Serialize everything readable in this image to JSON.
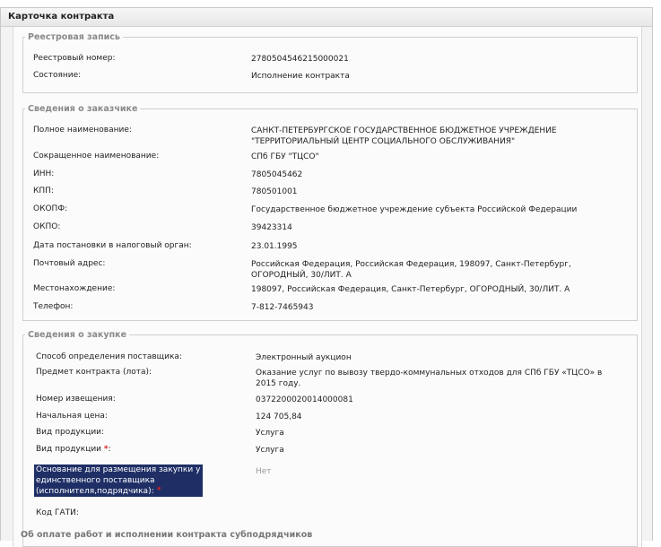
{
  "window": {
    "title": "Карточка контракта"
  },
  "registry": {
    "legend": "Реестровая запись",
    "rows": [
      {
        "label": "Реестровый номер:",
        "value": "2780504546215000021"
      },
      {
        "label": "Состояние:",
        "value": "Исполнение контракта"
      }
    ]
  },
  "customer": {
    "legend": "Сведения о заказчике",
    "rows": [
      {
        "label": "Полное наименование:",
        "value": "САНКТ-ПЕТЕРБУРГСКОЕ ГОСУДАРСТВЕННОЕ БЮДЖЕТНОЕ УЧРЕЖДЕНИЕ\n\"ТЕРРИТОРИАЛЬНЫЙ ЦЕНТР СОЦИАЛЬНОГО ОБСЛУЖИВАНИЯ\""
      },
      {
        "label": "Сокращенное наименование:",
        "value": "СПб ГБУ \"ТЦСО\""
      },
      {
        "label": "ИНН:",
        "value": "7805045462"
      },
      {
        "label": "КПП:",
        "value": "780501001"
      },
      {
        "label": "ОКОПФ:",
        "value": "Государственное бюджетное учреждение субъекта Российской Федерации"
      },
      {
        "label": "ОКПО:",
        "value": "39423314"
      },
      {
        "label": "Дата постановки в налоговый орган:",
        "value": "23.01.1995"
      },
      {
        "label": "Почтовый адрес:",
        "value": "Российская Федерация, Российская Федерация, 198097, Санкт-Петербург,\nОГОРОДНЫЙ, 30/ЛИТ. А"
      },
      {
        "label": "Местонахождение:",
        "value": "198097, Российская Федерация, Санкт-Петербург, ОГОРОДНЫЙ, 30/ЛИТ. А"
      },
      {
        "label": "Телефон:",
        "value": "7-812-7465943"
      }
    ]
  },
  "procurement": {
    "legend": "Сведения о закупке",
    "rows": [
      {
        "label": "Способ определения поставщика:",
        "value": "Электронный аукцион"
      },
      {
        "label": "Предмет контракта (лота):",
        "value": "Оказание услуг по вывозу твердо-коммунальных отходов для СПб ГБУ «ТЦСО» в\n2015 году."
      },
      {
        "label": "Номер извещения:",
        "value": "0372200020014000081"
      },
      {
        "label": "Начальная цена:",
        "value": "124 705,84"
      },
      {
        "label": "Вид продукции:",
        "value": "Услуга"
      },
      {
        "label": "Вид продукции",
        "value": "Услуга",
        "suffix": ":"
      },
      {
        "label": "Основание для размещения закупки у\nединственного поставщика\n(исполнителя,подрядчика):",
        "value": "Нет"
      },
      {
        "label": "Код ГАТИ:",
        "value": ""
      }
    ],
    "required_mark": "*"
  },
  "next_section": {
    "legend": "Об оплате работ и исполнении контракта субподрядчиков"
  }
}
